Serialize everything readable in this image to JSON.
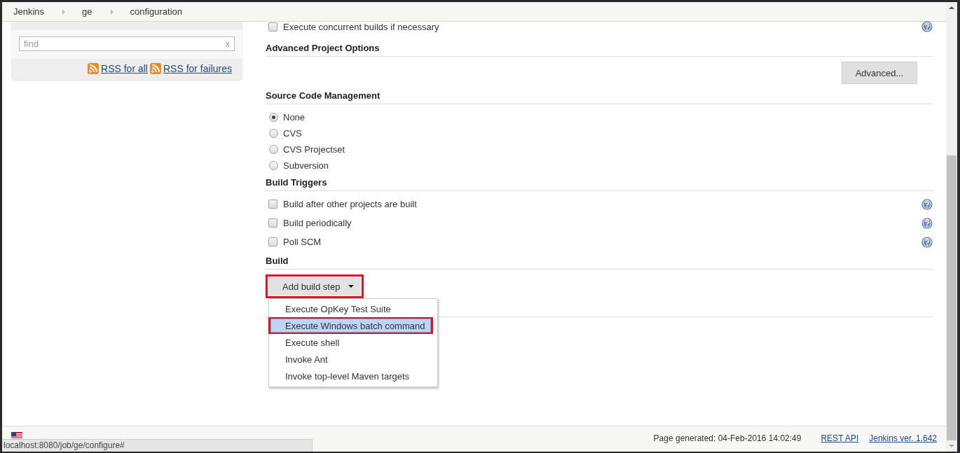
{
  "breadcrumbs": [
    {
      "label": "Jenkins"
    },
    {
      "label": "ge"
    },
    {
      "label": "configuration"
    }
  ],
  "sidebar": {
    "search": {
      "placeholder": "find",
      "clear": "x"
    },
    "rss_links": [
      "RSS for all",
      "RSS for failures"
    ]
  },
  "top_options": [
    {
      "kind": "checkbox",
      "label": "Execute concurrent builds if necessary",
      "checked": false,
      "help": true
    }
  ],
  "sections": [
    {
      "title": "Advanced Project Options",
      "items": [
        {
          "kind": "button",
          "label": "Advanced..."
        }
      ]
    },
    {
      "title": "Source Code Management",
      "items": [
        {
          "kind": "radio",
          "label": "None",
          "selected": true
        },
        {
          "kind": "radio",
          "label": "CVS",
          "selected": false
        },
        {
          "kind": "radio",
          "label": "CVS Projectset",
          "selected": false
        },
        {
          "kind": "radio",
          "label": "Subversion",
          "selected": false
        }
      ]
    },
    {
      "title": "Build Triggers",
      "items": [
        {
          "kind": "checkbox",
          "label": "Build after other projects are built",
          "checked": false,
          "help": true
        },
        {
          "kind": "checkbox",
          "label": "Build periodically",
          "checked": false,
          "help": true
        },
        {
          "kind": "checkbox",
          "label": "Poll SCM",
          "checked": false,
          "help": true
        }
      ]
    },
    {
      "title": "Build",
      "items": [
        {
          "kind": "dropdown",
          "label": "Add build step",
          "highlighted": true
        }
      ]
    }
  ],
  "build_step_menu": {
    "items": [
      {
        "label": "Execute OpKey Test Suite",
        "selected": false,
        "highlighted": false
      },
      {
        "label": "Execute Windows batch command",
        "selected": true,
        "highlighted": true
      },
      {
        "label": "Execute shell",
        "selected": false,
        "highlighted": false
      },
      {
        "label": "Invoke Ant",
        "selected": false,
        "highlighted": false
      },
      {
        "label": "Invoke top-level Maven targets",
        "selected": false,
        "highlighted": false
      }
    ]
  },
  "footer": {
    "generated": "Page generated: 04-Feb-2016 14:02:49",
    "links": [
      "REST API",
      "Jenkins ver. 1.642"
    ]
  },
  "status_url": "localhost:8080/job/ge/configure#"
}
